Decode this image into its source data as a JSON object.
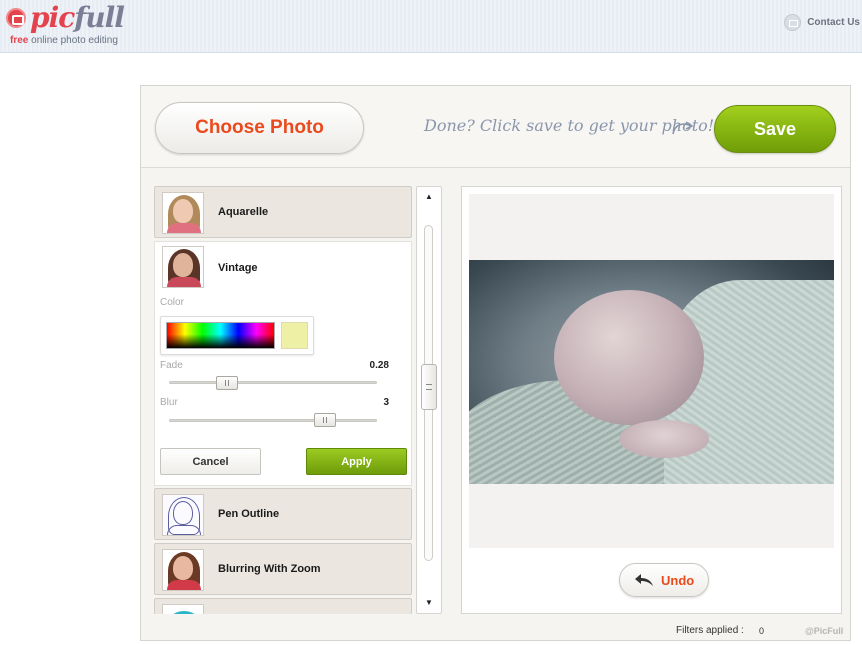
{
  "header": {
    "logo_pic": "pic",
    "logo_full": "full",
    "tagline_free": "free",
    "tagline_rest": " online photo editing",
    "contact_label": "Contact Us"
  },
  "toolbar": {
    "choose_label": "Choose Photo",
    "hint": "Done? Click save to get your photo!",
    "save_label": "Save"
  },
  "filters": {
    "items": [
      {
        "name": "Aquarelle",
        "thumb": "aquarelle-thumbnail"
      },
      {
        "name": "Vintage",
        "thumb": "vintage-thumbnail"
      },
      {
        "name": "Pen Outline",
        "thumb": "pen-outline-thumbnail"
      },
      {
        "name": "Blurring With Zoom",
        "thumb": "blurring-zoom-thumbnail"
      },
      {
        "name": "",
        "thumb": "partial-thumbnail"
      }
    ],
    "expanded": {
      "color_label": "Color",
      "selected_color": "#eef0a6",
      "fade_label": "Fade",
      "fade_value": "0.28",
      "blur_label": "Blur",
      "blur_value": "3",
      "cancel_label": "Cancel",
      "apply_label": "Apply"
    }
  },
  "scrollbar": {
    "up_glyph": "▲",
    "down_glyph": "▼"
  },
  "preview": {
    "image": "sleeping-baby-photo",
    "undo_label": "Undo"
  },
  "footer": {
    "filters_applied_label": "Filters applied :",
    "filters_applied_count": "0",
    "credit": "@PicFull"
  },
  "colors": {
    "brand_red": "#e4434e",
    "accent_orange": "#ea4a1c",
    "save_green": "#8bbd14"
  }
}
